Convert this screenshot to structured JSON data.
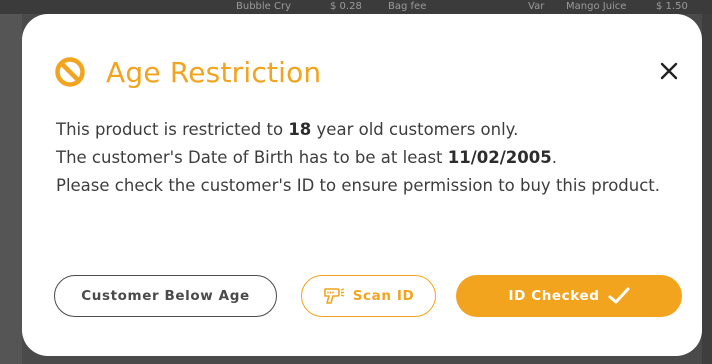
{
  "background": {
    "items": [
      "Bubble Cry",
      "$ 0.28",
      "Bag fee",
      "Var",
      "Mango Juice",
      "$ 1.50"
    ]
  },
  "modal": {
    "title": "Age Restriction",
    "accent_color": "#f2a41e",
    "message": {
      "line1_prefix": "This product is restricted to ",
      "min_age": "18",
      "line1_suffix": " year old customers only.",
      "line2_prefix": "The customer's Date of Birth has to be at least ",
      "dob_date": "11/02/2005",
      "line2_suffix": ".",
      "line3": "Please check the customer's ID to ensure permission to buy this product."
    },
    "buttons": {
      "below_age": "Customer Below Age",
      "scan_id": "Scan ID",
      "id_checked": "ID Checked"
    },
    "icons": {
      "title_icon": "ban-icon",
      "close_icon": "close-icon",
      "scanner_icon": "barcode-scanner-icon",
      "checkmark_icon": "checkmark-icon"
    }
  }
}
